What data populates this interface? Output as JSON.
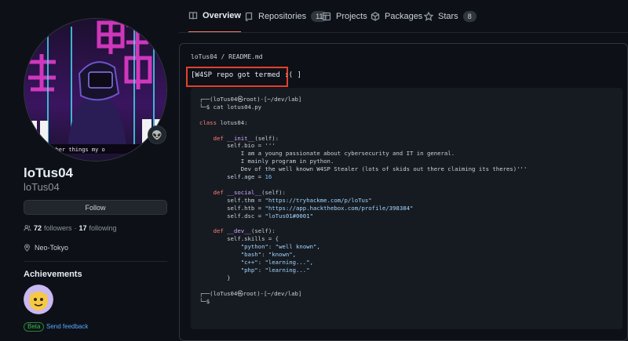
{
  "tabs": [
    {
      "label": "Overview",
      "icon": "book-icon",
      "active": true
    },
    {
      "label": "Repositories",
      "icon": "repo-icon",
      "count": "11"
    },
    {
      "label": "Projects",
      "icon": "table-icon"
    },
    {
      "label": "Packages",
      "icon": "package-icon"
    },
    {
      "label": "Stars",
      "icon": "star-icon",
      "count": "8"
    }
  ],
  "profile": {
    "avatar_caption": "> remember things my o",
    "status_emoji": "👽",
    "name": "loTus04",
    "login": "loTus04",
    "follow_label": "Follow",
    "followers_count": "72",
    "followers_label": "followers",
    "separator": "·",
    "following_count": "17",
    "following_label": "following",
    "location": "Neo-Tokyo",
    "achievements_title": "Achievements",
    "beta_label": "Beta",
    "feedback_label": "Send feedback"
  },
  "readme": {
    "path": "loTus04 / README.md",
    "highlight_line": "[W4SP repo got termed :( ]",
    "code_lines": [
      "┌──(loTus04㉿root)-[~/dev/lab]",
      "└─$ cat lotus04.py",
      "",
      "class lotus04:",
      "",
      "    def __init__(self):",
      "        self.bio = '''",
      "            I am a young passionate about cybersecurity and IT in general.",
      "            I mainly program in python.",
      "            Dev of the well known W4SP Stealer (lots of skids out there claiming its theres)'''",
      "        self.age = 16",
      "",
      "    def __social__(self):",
      "        self.thm = \"https://tryhackme.com/p/loTus\"",
      "        self.htb = \"https://app.hackthebox.com/profile/398384\"",
      "        self.dsc = \"loTus01#0001\"",
      "",
      "    def __dev__(self):",
      "        self.skills = {",
      "            \"python\": \"well known\",",
      "            \"bash\": \"known\",",
      "            \"c++\": \"learning...\",",
      "            \"php\": \"learning...\"",
      "        }",
      "",
      "┌──(loTus04㉿root)-[~/dev/lab]",
      "└─$"
    ]
  },
  "colors": {
    "background": "#0d1117",
    "accent_tab": "#f78166",
    "highlight_box": "#e5402b",
    "link": "#58a6ff"
  }
}
